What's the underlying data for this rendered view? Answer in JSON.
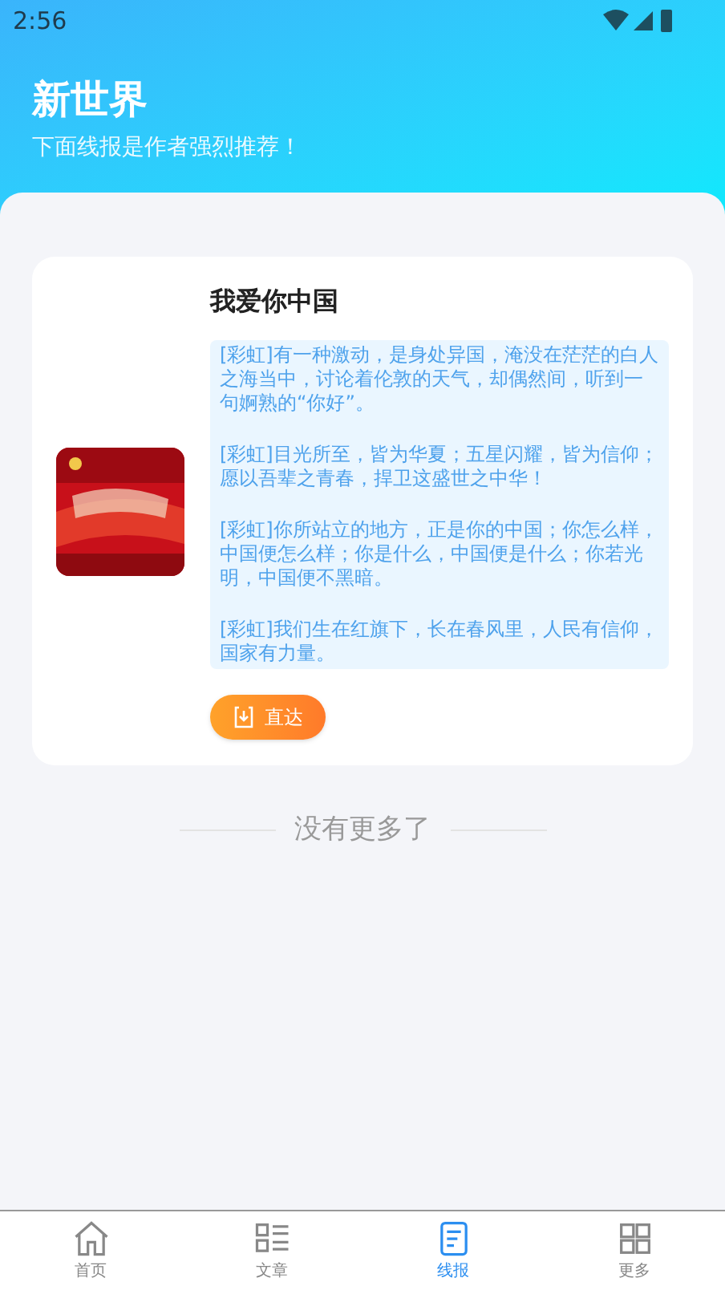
{
  "status_bar": {
    "time": "2:56"
  },
  "header": {
    "title": "新世界",
    "subtitle": "下面线报是作者强烈推荐！"
  },
  "cards": [
    {
      "kind": "picture",
      "title": "我爱你中国",
      "paragraphs": [
        "[彩虹]有一种激动，是身处异国，淹没在茫茫的白人之海当中，讨论着伦敦的天气，却偶然间，听到一句婀熟的“你好”。",
        "[彩虹]目光所至，皆为华夏；五星闪耀，皆为信仰；愿以吾辈之青春，捍卫这盛世之中华！",
        "[彩虹]你所站立的地方，正是你的中国；你怎么样，中国便怎么样；你是什么，中国便是什么；你若光明，中国便不黑暗。",
        "[彩虹]我们生在红旗下，长在春风里，人民有信仰，国家有力量。"
      ],
      "button": "直达"
    }
  ],
  "end_text": "没有更多了",
  "tabs": [
    {
      "kind": "home",
      "label": "首页",
      "selected": false
    },
    {
      "kind": "list",
      "label": "文章",
      "selected": false
    },
    {
      "kind": "doc",
      "label": "线报",
      "selected": true
    },
    {
      "kind": "more",
      "label": "更多",
      "selected": false
    }
  ]
}
